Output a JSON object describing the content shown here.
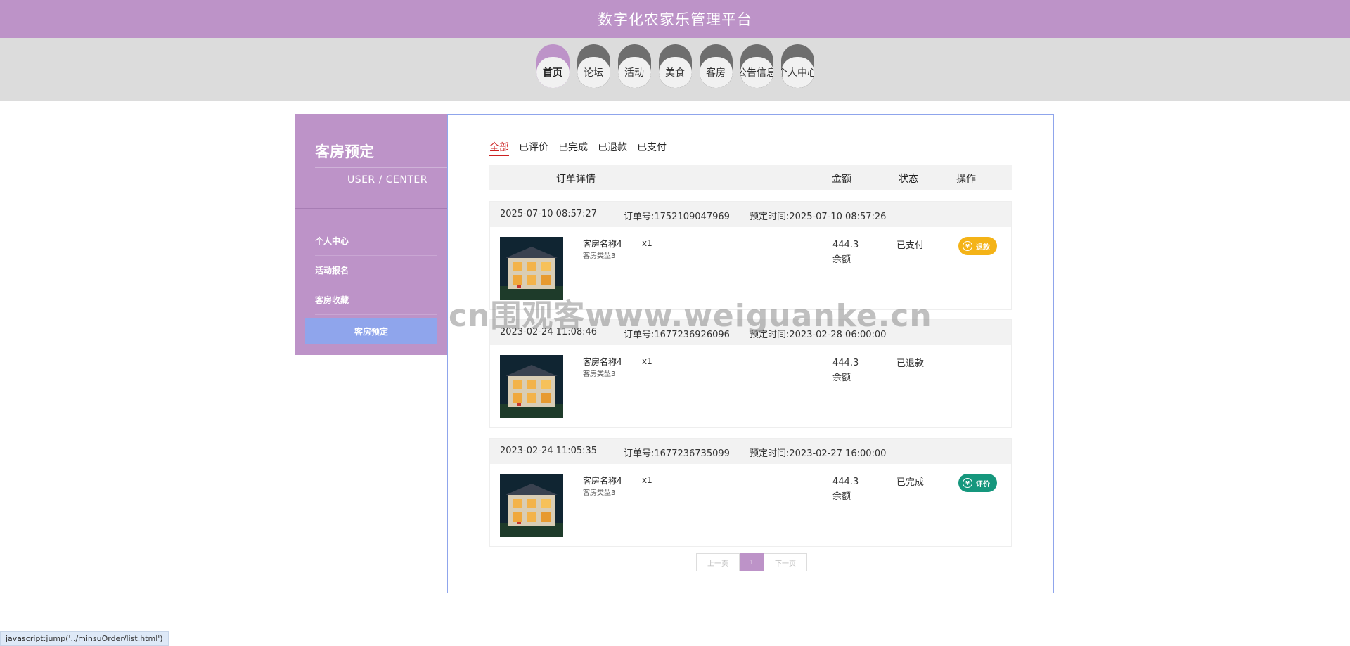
{
  "header": {
    "title": "数字化农家乐管理平台"
  },
  "nav": {
    "items": [
      {
        "label": "首页",
        "active": true
      },
      {
        "label": "论坛"
      },
      {
        "label": "活动"
      },
      {
        "label": "美食"
      },
      {
        "label": "客房"
      },
      {
        "label": "公告信息"
      },
      {
        "label": "个人中心"
      }
    ]
  },
  "sidebar": {
    "title": "客房预定",
    "subtitle": "USER / CENTER",
    "items": [
      {
        "label": "个人中心"
      },
      {
        "label": "活动报名"
      },
      {
        "label": "客房收藏"
      },
      {
        "label": "客房预定",
        "active": true
      }
    ]
  },
  "tabs": [
    "全部",
    "已评价",
    "已完成",
    "已退款",
    "已支付"
  ],
  "table_header": {
    "detail": "订单详情",
    "amount": "金额",
    "status": "状态",
    "action": "操作"
  },
  "orders": [
    {
      "created": "2025-07-10 08:57:27",
      "order_no": "订单号:1752109047969",
      "reserve_time": "预定时间:2025-07-10 08:57:26",
      "room_name": "客房名称4",
      "room_type": "客房类型3",
      "qty": "x1",
      "amount": "444.3",
      "pay_method": "余额",
      "status": "已支付",
      "action": "退款"
    },
    {
      "created": "2023-02-24 11:08:46",
      "order_no": "订单号:1677236926096",
      "reserve_time": "预定时间:2023-02-28 06:00:00",
      "room_name": "客房名称4",
      "room_type": "客房类型3",
      "qty": "x1",
      "amount": "444.3",
      "pay_method": "余额",
      "status": "已退款"
    },
    {
      "created": "2023-02-24 11:05:35",
      "order_no": "订单号:1677236735099",
      "reserve_time": "预定时间:2023-02-27 16:00:00",
      "room_name": "客房名称4",
      "room_type": "客房类型3",
      "qty": "x1",
      "amount": "444.3",
      "pay_method": "余额",
      "status": "已完成",
      "action": "评价"
    }
  ],
  "pager": {
    "prev": "上一页",
    "current": "1",
    "next": "下一页"
  },
  "watermark": "cn围观客www.weiguanke.cn",
  "statusbar": "javascript:jump('../minsuOrder/list.html')",
  "colors": {
    "accent": "#bd93c8",
    "active_menu": "#8fa5ec",
    "refund_btn": "#f4b317",
    "rate_btn": "#15977d",
    "active_tab": "#cc2222"
  }
}
